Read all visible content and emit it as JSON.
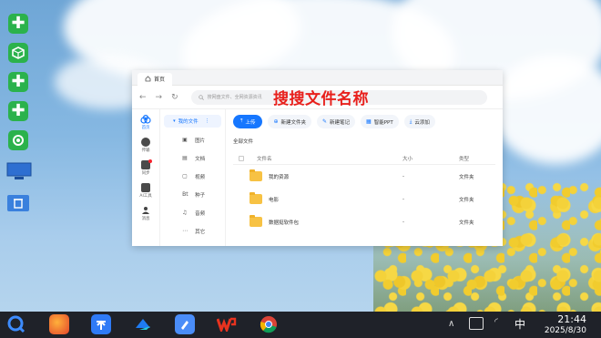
{
  "window": {
    "tab_title": "首页",
    "search_placeholder": "搜网盘文件、全网资源资讯",
    "overlay_title": "搜搜文件名称"
  },
  "rail": [
    {
      "label": "首页",
      "icon": "cloud-icon",
      "active": true
    },
    {
      "label": "传输",
      "icon": "transfer-icon"
    },
    {
      "label": "同步",
      "icon": "sync-icon",
      "badge": true
    },
    {
      "label": "AI工具",
      "icon": "ai-icon"
    },
    {
      "label": "消息",
      "icon": "message-icon"
    }
  ],
  "tree": {
    "head": "我的文件",
    "items": [
      {
        "label": "图片",
        "icon": "image-icon"
      },
      {
        "label": "文档",
        "icon": "document-icon"
      },
      {
        "label": "视频",
        "icon": "video-icon"
      },
      {
        "label": "种子",
        "icon": "torrent-icon"
      },
      {
        "label": "音频",
        "icon": "audio-icon"
      },
      {
        "label": "其它",
        "icon": "more-icon"
      }
    ]
  },
  "actions": {
    "upload": "上传",
    "new_folder": "新建文件夹",
    "new_note": "新建笔记",
    "ppt": "智能PPT",
    "cloud_add": "云添加"
  },
  "breadcrumb": "全部文件",
  "table": {
    "headers": {
      "name": "文件名",
      "size": "大小",
      "type": "类型"
    },
    "rows": [
      {
        "name": "我的资源",
        "size": "-",
        "type": "文件夹"
      },
      {
        "name": "电影",
        "size": "-",
        "type": "文件夹"
      },
      {
        "name": "数据挺软件包",
        "size": "-",
        "type": "文件夹"
      }
    ]
  },
  "taskbar": {
    "ime": "中",
    "time": "21:44",
    "date": "2025/8/30"
  },
  "colors": {
    "accent": "#1677ff",
    "overlay_red": "#e8201c",
    "folder": "#f7c244",
    "taskbar": "#1f2229"
  }
}
